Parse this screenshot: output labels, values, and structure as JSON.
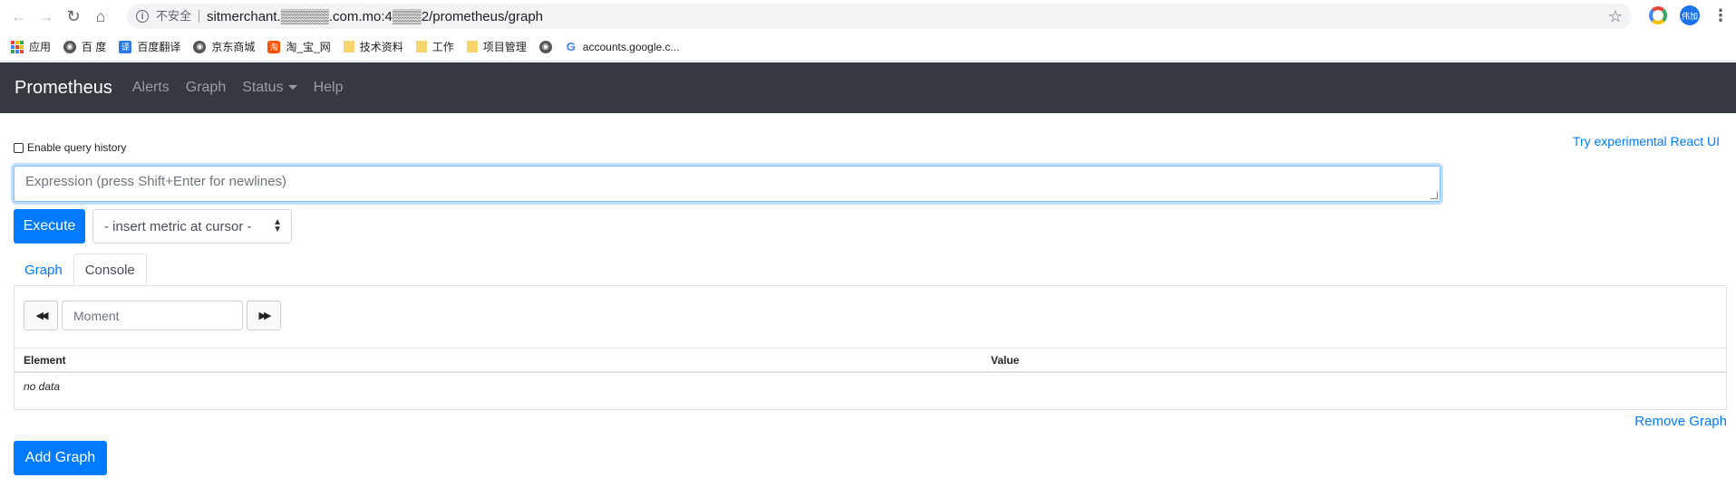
{
  "browser": {
    "url": "sitmerchant.▒▒▒▒▒.com.mo:4▒▒▒2/prometheus/graph",
    "security_label": "不安全",
    "avatar_label": "伟加"
  },
  "bookmarks": [
    {
      "label": "应用",
      "icon": "apps-icon"
    },
    {
      "label": "百 度",
      "icon": "globe-icon"
    },
    {
      "label": "百度翻译",
      "icon": "fanyi-icon"
    },
    {
      "label": "京东商城",
      "icon": "globe-icon"
    },
    {
      "label": "淘_宝_网",
      "icon": "taobao-icon"
    },
    {
      "label": "技术资料",
      "icon": "folder-icon"
    },
    {
      "label": "工作",
      "icon": "folder-icon"
    },
    {
      "label": "项目管理",
      "icon": "folder-icon"
    },
    {
      "label": "",
      "icon": "globe-icon"
    },
    {
      "label": "accounts.google.c...",
      "icon": "google-icon"
    }
  ],
  "navbar": {
    "brand": "Prometheus",
    "links": [
      "Alerts",
      "Graph",
      "Status",
      "Help"
    ]
  },
  "page": {
    "history_label": "Enable query history",
    "react_link": "Try experimental React UI",
    "expression_placeholder": "Expression (press Shift+Enter for newlines)",
    "execute_label": "Execute",
    "metric_select": "- insert metric at cursor -",
    "tabs": [
      "Graph",
      "Console"
    ],
    "moment_placeholder": "Moment",
    "table_headers": [
      "Element",
      "Value"
    ],
    "no_data": "no data",
    "remove_graph": "Remove Graph",
    "add_graph": "Add Graph"
  }
}
